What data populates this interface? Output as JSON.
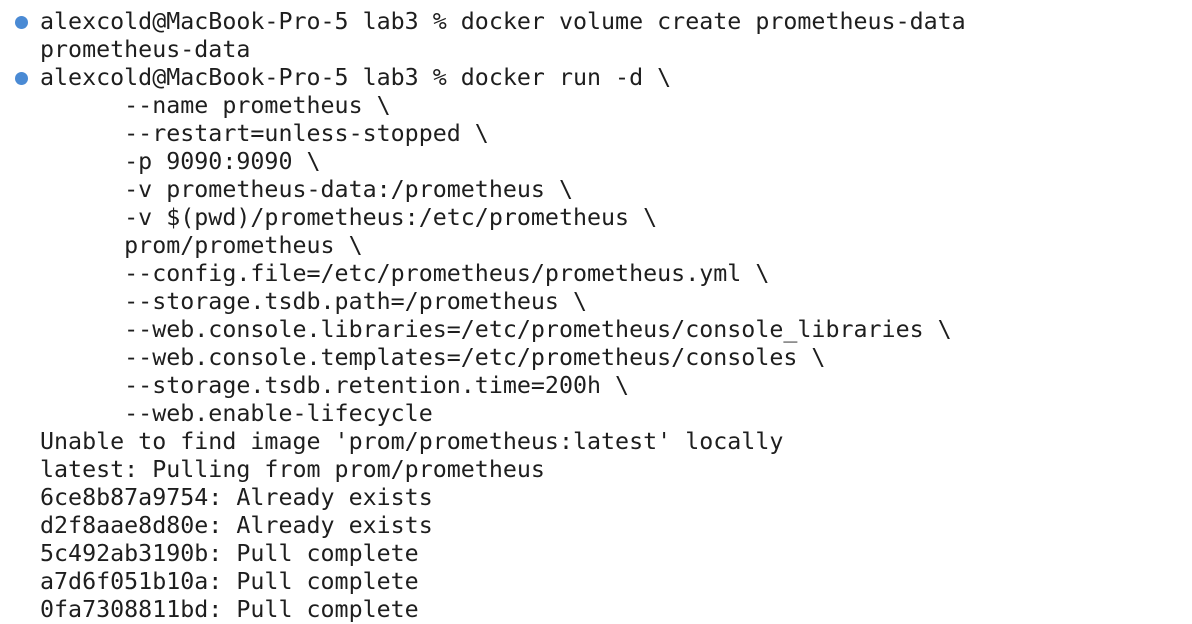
{
  "terminal": {
    "prompt_dot_color": "#4a8ad4",
    "lines": [
      {
        "text": "alexcold@MacBook-Pro-5 lab3 % docker volume create prometheus-data",
        "prompt": true
      },
      {
        "text": "prometheus-data",
        "prompt": false
      },
      {
        "text": "alexcold@MacBook-Pro-5 lab3 % docker run -d \\",
        "prompt": true
      },
      {
        "text": "      --name prometheus \\",
        "prompt": false
      },
      {
        "text": "      --restart=unless-stopped \\",
        "prompt": false
      },
      {
        "text": "      -p 9090:9090 \\",
        "prompt": false
      },
      {
        "text": "      -v prometheus-data:/prometheus \\",
        "prompt": false
      },
      {
        "text": "      -v $(pwd)/prometheus:/etc/prometheus \\",
        "prompt": false
      },
      {
        "text": "      prom/prometheus \\",
        "prompt": false
      },
      {
        "text": "      --config.file=/etc/prometheus/prometheus.yml \\",
        "prompt": false
      },
      {
        "text": "      --storage.tsdb.path=/prometheus \\",
        "prompt": false
      },
      {
        "text": "      --web.console.libraries=/etc/prometheus/console_libraries \\",
        "prompt": false
      },
      {
        "text": "      --web.console.templates=/etc/prometheus/consoles \\",
        "prompt": false
      },
      {
        "text": "      --storage.tsdb.retention.time=200h \\",
        "prompt": false
      },
      {
        "text": "      --web.enable-lifecycle",
        "prompt": false
      },
      {
        "text": "Unable to find image 'prom/prometheus:latest' locally",
        "prompt": false
      },
      {
        "text": "latest: Pulling from prom/prometheus",
        "prompt": false
      },
      {
        "text": "6ce8b87a9754: Already exists",
        "prompt": false
      },
      {
        "text": "d2f8aae8d80e: Already exists",
        "prompt": false
      },
      {
        "text": "5c492ab3190b: Pull complete",
        "prompt": false
      },
      {
        "text": "a7d6f051b10a: Pull complete",
        "prompt": false
      },
      {
        "text": "0fa7308811bd: Pull complete",
        "prompt": false
      }
    ]
  }
}
